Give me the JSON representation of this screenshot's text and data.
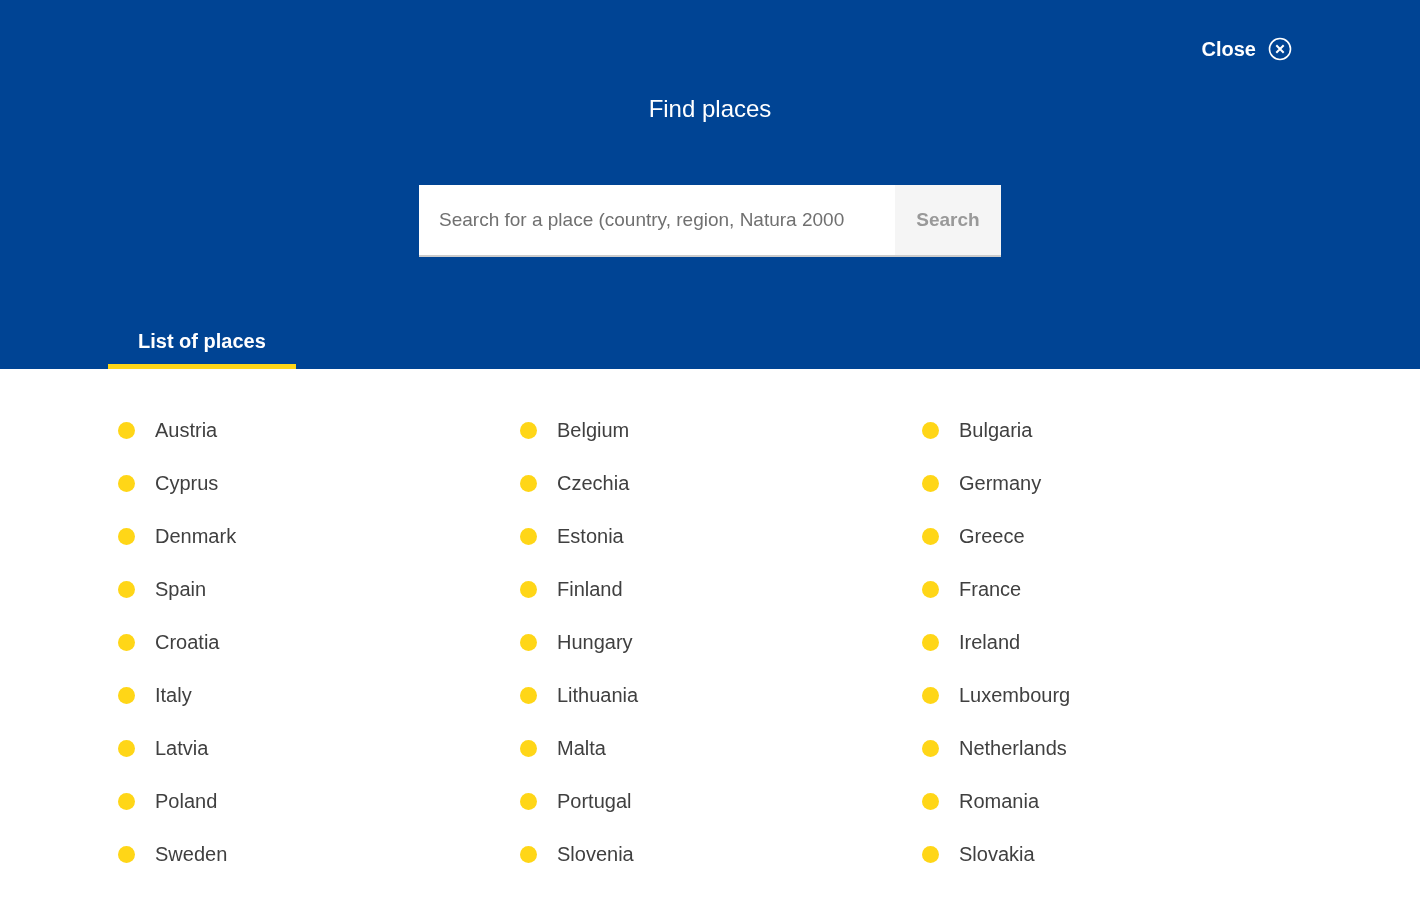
{
  "close": {
    "label": "Close"
  },
  "title": "Find places",
  "search": {
    "placeholder": "Search for a place (country, region, Natura 2000",
    "button": "Search"
  },
  "tabs": [
    {
      "label": "List of places",
      "selected": true
    }
  ],
  "places": [
    "Austria",
    "Belgium",
    "Bulgaria",
    "Cyprus",
    "Czechia",
    "Germany",
    "Denmark",
    "Estonia",
    "Greece",
    "Spain",
    "Finland",
    "France",
    "Croatia",
    "Hungary",
    "Ireland",
    "Italy",
    "Lithuania",
    "Luxembourg",
    "Latvia",
    "Malta",
    "Netherlands",
    "Poland",
    "Portugal",
    "Romania",
    "Sweden",
    "Slovenia",
    "Slovakia"
  ]
}
